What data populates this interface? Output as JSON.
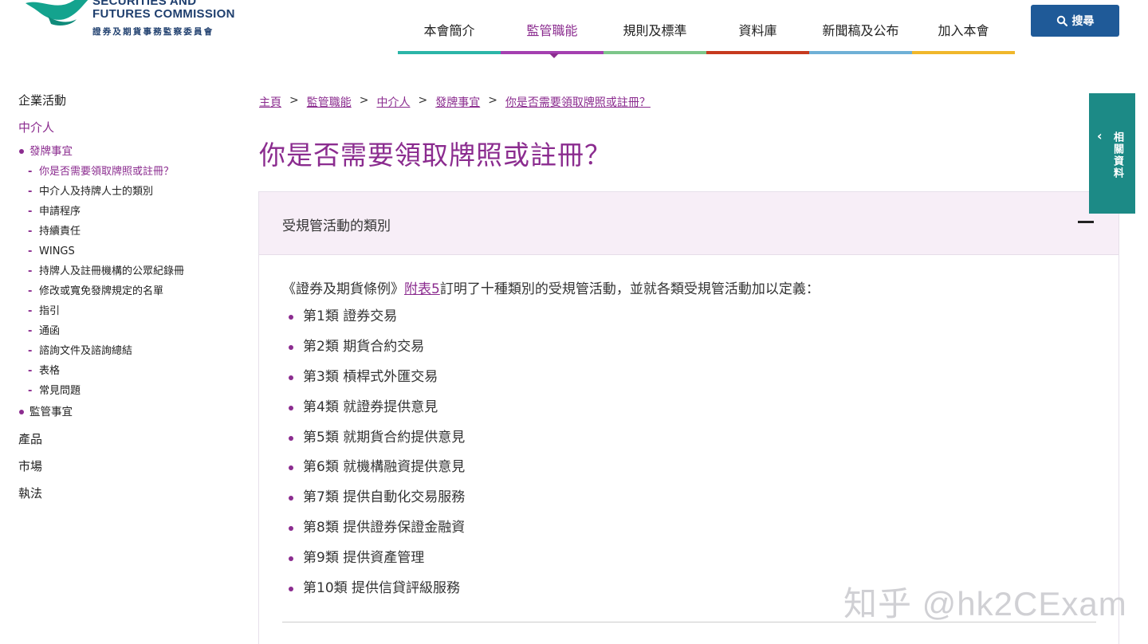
{
  "logo": {
    "en_line1": "SECURITIES AND",
    "en_line2": "FUTURES COMMISSION",
    "zh": "證券及期貨事務監察委員會"
  },
  "nav": {
    "items": [
      {
        "label": "本會簡介",
        "color": "#2bb5a8"
      },
      {
        "label": "監管職能",
        "color": "#a43fb0"
      },
      {
        "label": "規則及標準",
        "color": "#7dc68a"
      },
      {
        "label": "資料庫",
        "color": "#c63a1f"
      },
      {
        "label": "新聞稿及公布",
        "color": "#6fb0d6"
      },
      {
        "label": "加入本會",
        "color": "#f0b72b"
      }
    ],
    "active_index": 1
  },
  "search": {
    "label": "搜尋"
  },
  "sidebar": {
    "top_items": [
      "企業活動",
      "中介人",
      "產品",
      "市場",
      "執法"
    ],
    "active_top": "中介人",
    "licensing": "發牌事宜",
    "sub_items": [
      "你是否需要領取牌照或註冊？",
      "中介人及持牌人士的類別",
      "申請程序",
      "持續責任",
      "WINGS",
      "持牌人及註冊機構的公眾紀錄冊",
      "修改或寬免發牌規定的名單",
      "指引",
      "通函",
      "諮詢文件及諮詢總結",
      "表格",
      "常見問題"
    ],
    "supervision": "監管事宜"
  },
  "breadcrumb": [
    "主頁",
    "監管職能",
    "中介人",
    "發牌事宜",
    "你是否需要領取牌照或註冊？"
  ],
  "page_title": "你是否需要領取牌照或註冊？",
  "accordion": {
    "title": "受規管活動的類別",
    "intro_prefix": "《證券及期貨條例》",
    "intro_link": "附表5",
    "intro_suffix": "訂明了十種類別的受規管活動，並就各類受規管活動加以定義：",
    "categories": [
      "第1類 證券交易",
      "第2類 期貨合約交易",
      "第3類 槓桿式外匯交易",
      "第4類 就證券提供意見",
      "第5類 就期貨合約提供意見",
      "第6類 就機構融資提供意見",
      "第7類 提供自動化交易服務",
      "第8類 提供證券保證金融資",
      "第9類 提供資產管理",
      "第10類 提供信貸評級服務"
    ]
  },
  "related_tab": {
    "label": "相關資料"
  },
  "watermark": "知乎 @hk2CExam",
  "colors": {
    "accent": "#8b2c8f",
    "search_bg": "#1f5a98",
    "related_bg": "#1c8a86",
    "accordion_head_bg": "#f7eef7"
  }
}
